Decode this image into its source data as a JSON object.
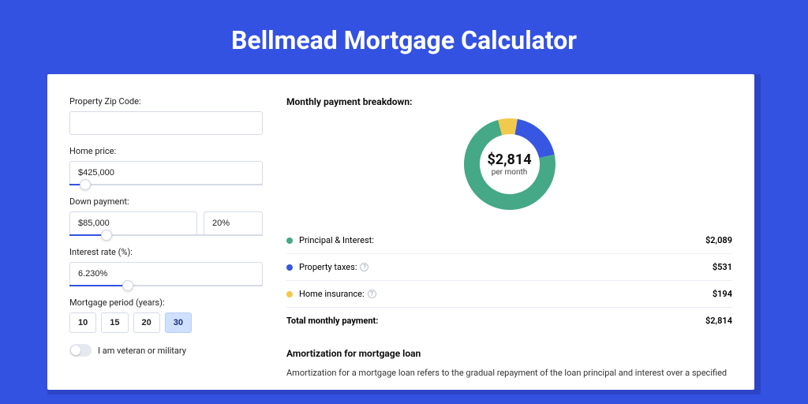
{
  "title": "Bellmead Mortgage Calculator",
  "colors": {
    "principal": "#45a887",
    "taxes": "#3756e2",
    "insurance": "#f1c94b"
  },
  "form": {
    "zip": {
      "label": "Property Zip Code:",
      "value": ""
    },
    "home_price": {
      "label": "Home price:",
      "value": "$425,000",
      "slider_pct": 8
    },
    "down_payment": {
      "label": "Down payment:",
      "amount": "$85,000",
      "pct": "20%",
      "slider_pct": 19
    },
    "interest_rate": {
      "label": "Interest rate (%):",
      "value": "6.230%",
      "slider_pct": 30
    },
    "period": {
      "label": "Mortgage period (years):",
      "options": [
        "10",
        "15",
        "20",
        "30"
      ],
      "active": "30"
    },
    "veteran": {
      "label": "I am veteran or military",
      "value": false
    }
  },
  "breakdown": {
    "heading": "Monthly payment breakdown:",
    "center_amount": "$2,814",
    "center_sub": "per month",
    "principal": {
      "label": "Principal & Interest:",
      "value": "$2,089",
      "share": 74.2
    },
    "taxes": {
      "label": "Property taxes:",
      "value": "$531",
      "share": 18.9
    },
    "insurance": {
      "label": "Home insurance:",
      "value": "$194",
      "share": 6.9
    },
    "total_label": "Total monthly payment:",
    "total_value": "$2,814"
  },
  "amortization": {
    "heading": "Amortization for mortgage loan",
    "text": "Amortization for a mortgage loan refers to the gradual repayment of the loan principal and interest over a specified"
  },
  "chart_data": {
    "type": "pie",
    "title": "Monthly payment breakdown",
    "series": [
      {
        "name": "Principal & Interest",
        "value": 2089
      },
      {
        "name": "Property taxes",
        "value": 531
      },
      {
        "name": "Home insurance",
        "value": 194
      }
    ],
    "total": 2814,
    "unit": "USD/month"
  }
}
